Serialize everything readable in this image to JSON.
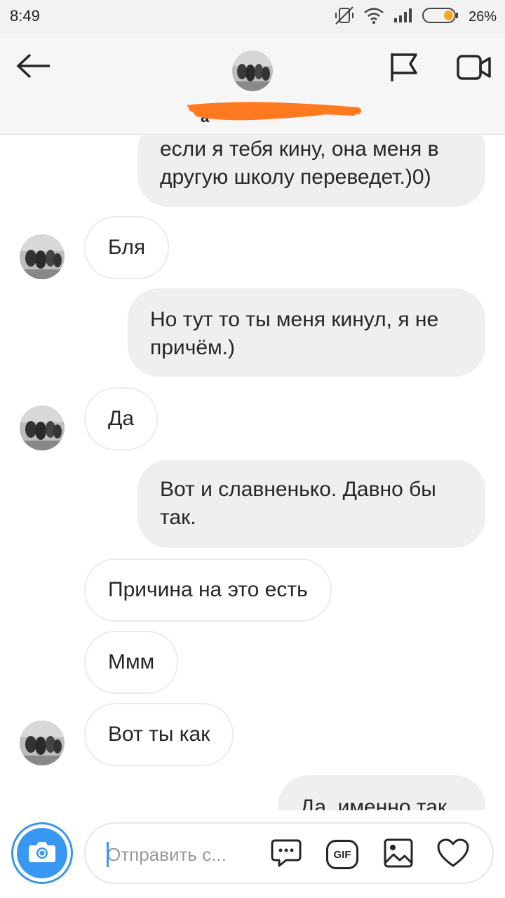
{
  "status_bar": {
    "time": "8:49",
    "battery_percent": "26%",
    "icons": [
      "mute-vibrate-icon",
      "wifi-icon",
      "signal-icon",
      "battery-icon"
    ]
  },
  "header": {
    "icons": [
      "back-arrow-icon",
      "flag-icon",
      "video-camera-icon"
    ]
  },
  "messages": [
    {
      "side": "out",
      "text": "если я тебя кину, она меня в другую школу переведет.)0)"
    },
    {
      "side": "in",
      "text": "Бля",
      "avatar": true
    },
    {
      "side": "out",
      "text": "Но тут то ты меня кинул, я не причём.)"
    },
    {
      "side": "in",
      "text": "Да",
      "avatar": true
    },
    {
      "side": "out",
      "text": "Вот и славненько. Давно бы так."
    },
    {
      "side": "in",
      "text": "Причина на это есть",
      "avatar": false
    },
    {
      "side": "in",
      "text": "Ммм",
      "avatar": false
    },
    {
      "side": "in",
      "text": "Вот ты как",
      "avatar": true
    },
    {
      "side": "out",
      "text": "Да, именно так"
    }
  ],
  "composer": {
    "placeholder": "Отправить с...",
    "icons": [
      "camera-icon",
      "sticker-icon",
      "gif-icon",
      "gallery-icon",
      "heart-icon"
    ],
    "gif_label": "GIF"
  },
  "colors": {
    "accent": "#3897f0",
    "out_bubble": "#efefef",
    "in_border": "#ececec",
    "redaction": "#ff7a1f"
  }
}
